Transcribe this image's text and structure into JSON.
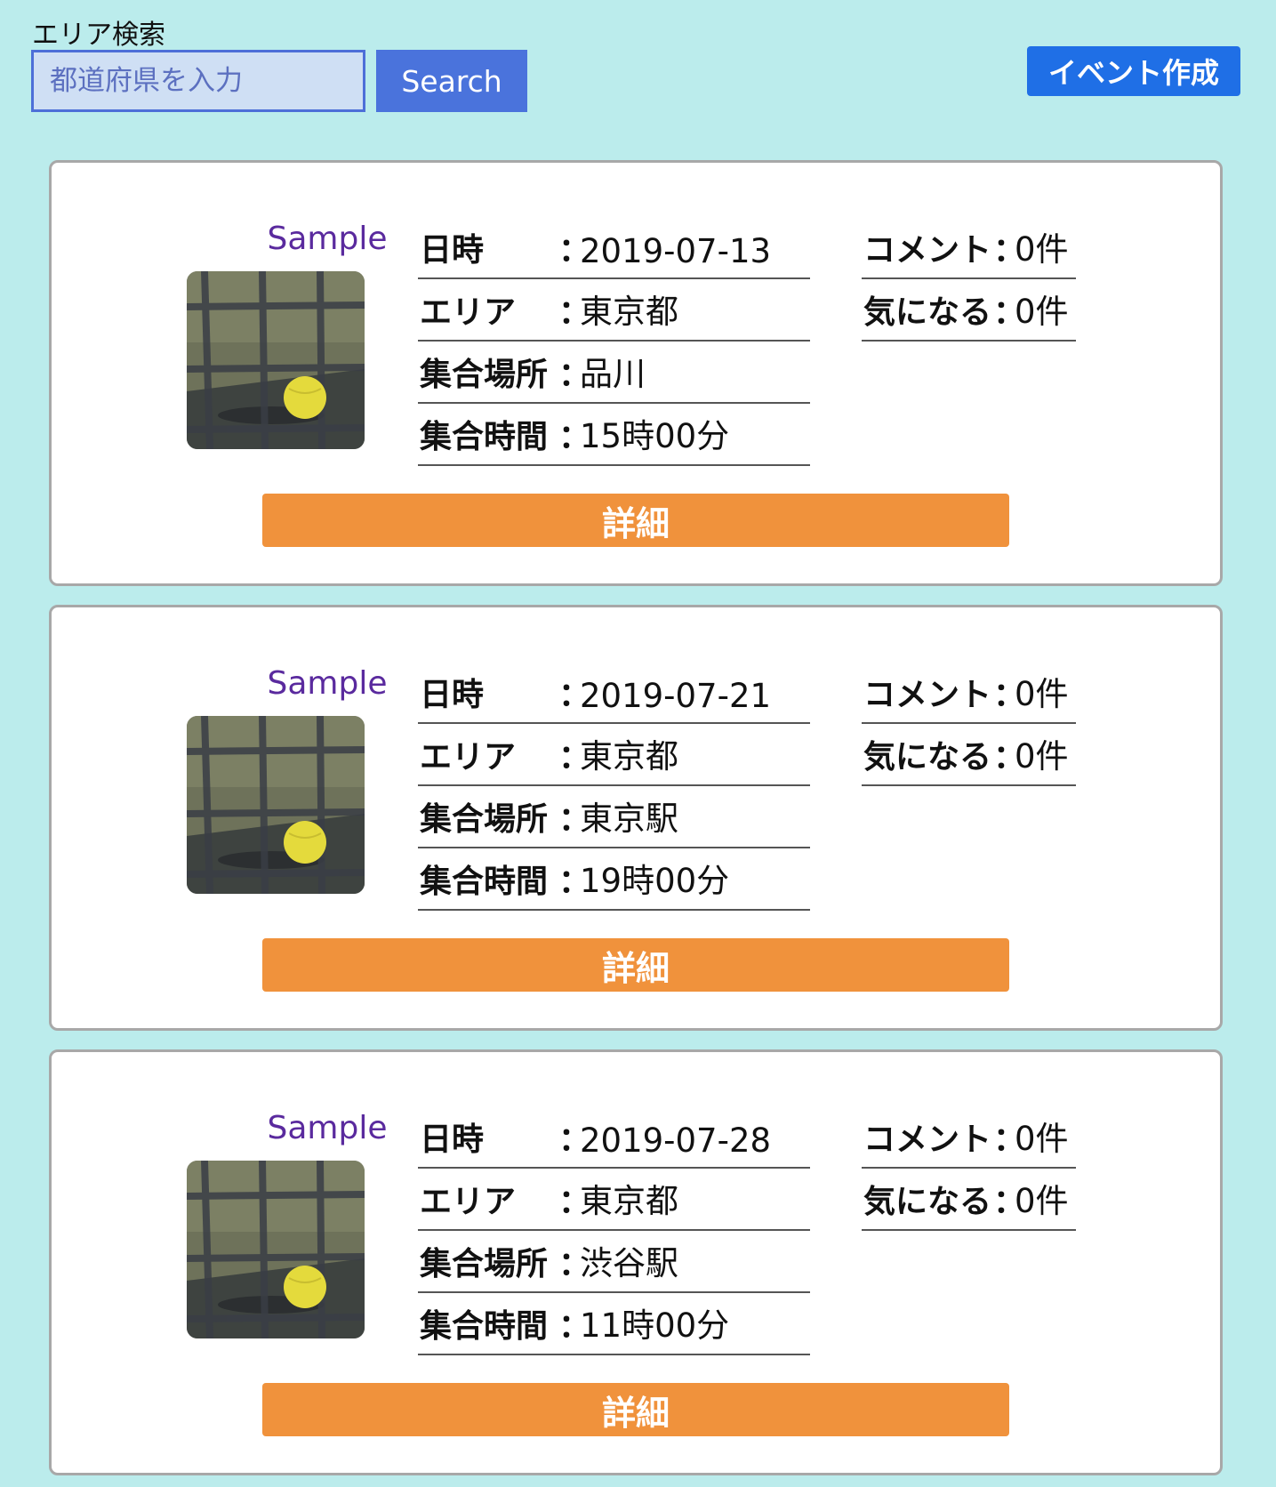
{
  "search": {
    "label": "エリア検索",
    "placeholder": "都道府県を入力",
    "button_label": "Search"
  },
  "header": {
    "create_event_label": "イベント作成"
  },
  "labels": {
    "date": "日時",
    "area": "エリア",
    "meeting_place": "集合場所",
    "meeting_time": "集合時間",
    "comments": "コメント",
    "interested": "気になる",
    "separator": "：",
    "details_button": "詳細"
  },
  "events": [
    {
      "sample_label": "Sample",
      "image": "tennis-ball-photo",
      "date": "2019-07-13",
      "area": "東京都",
      "meeting_place": "品川",
      "meeting_time": "15時00分",
      "comments": "0件",
      "interested": "0件"
    },
    {
      "sample_label": "Sample",
      "image": "tennis-ball-photo",
      "date": "2019-07-21",
      "area": "東京都",
      "meeting_place": "東京駅",
      "meeting_time": "19時00分",
      "comments": "0件",
      "interested": "0件"
    },
    {
      "sample_label": "Sample",
      "image": "tennis-ball-photo",
      "date": "2019-07-28",
      "area": "東京都",
      "meeting_place": "渋谷駅",
      "meeting_time": "11時00分",
      "comments": "0件",
      "interested": "0件"
    }
  ],
  "colors": {
    "background": "#bbecec",
    "search_button": "#4a73dc",
    "create_button": "#1f6fe6",
    "detail_button": "#f0923c",
    "sample_text": "#5a2a9e"
  }
}
